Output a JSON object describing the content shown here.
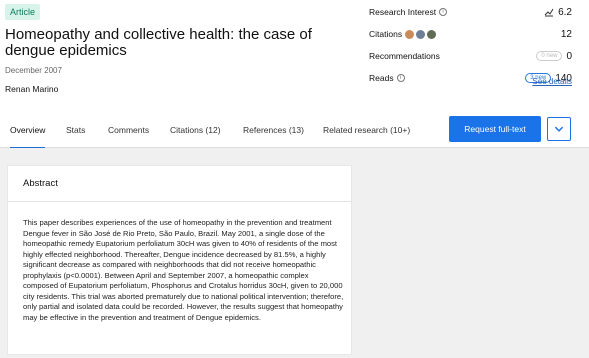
{
  "article": {
    "badge": "Article",
    "title": "Homeopathy and collective health: the case of dengue epidemics",
    "date": "December 2007",
    "author": "Renan Marino"
  },
  "metrics": {
    "research_interest_label": "Research Interest",
    "research_interest_value": "6.2",
    "citations_label": "Citations",
    "citations_value": "12",
    "recommendations_label": "Recommendations",
    "recommendations_pill": "0 new",
    "recommendations_value": "0",
    "reads_label": "Reads",
    "reads_pill": "3 new",
    "reads_value": "140",
    "see_details": "See details"
  },
  "tabs": [
    {
      "label": "Overview"
    },
    {
      "label": "Stats"
    },
    {
      "label": "Comments"
    },
    {
      "label": "Citations (12)"
    },
    {
      "label": "References (13)"
    },
    {
      "label": "Related research (10+)"
    }
  ],
  "actions": {
    "request_full_text": "Request full-text"
  },
  "abstract": {
    "heading": "Abstract",
    "text": "This paper describes experiences of the use of homeopathy in the prevention and treatment Dengue fever in São José de Rio Preto, São Paulo, Brazil. May 2001, a single dose of the homeopathic remedy Eupatorium perfoliatum 30cH was given to 40% of residents of the most highly effected neighborhood. Thereafter, Dengue incidence decreased by 81.5%, a highly significant decrease as compared with neighborhoods that did not receive homeopathic prophylaxis (p<0.0001). Between April and September 2007, a homeopathic complex composed of Eupatorium perfoliatum, Phosphorus and Crotalus horridus 30cH, given to 20,000 city residents. This trial was aborted prematurely due to national political intervention; therefore, only partial and isolated data could be recorded. However, the results suggest that homeopathy may be effective in the prevention and treatment of Dengue epidemics."
  },
  "colors": {
    "accent": "#1a73e8",
    "badge_bg": "#d8f3ea",
    "badge_text": "#0b7a5c",
    "body_bg": "#f0f0f0"
  }
}
